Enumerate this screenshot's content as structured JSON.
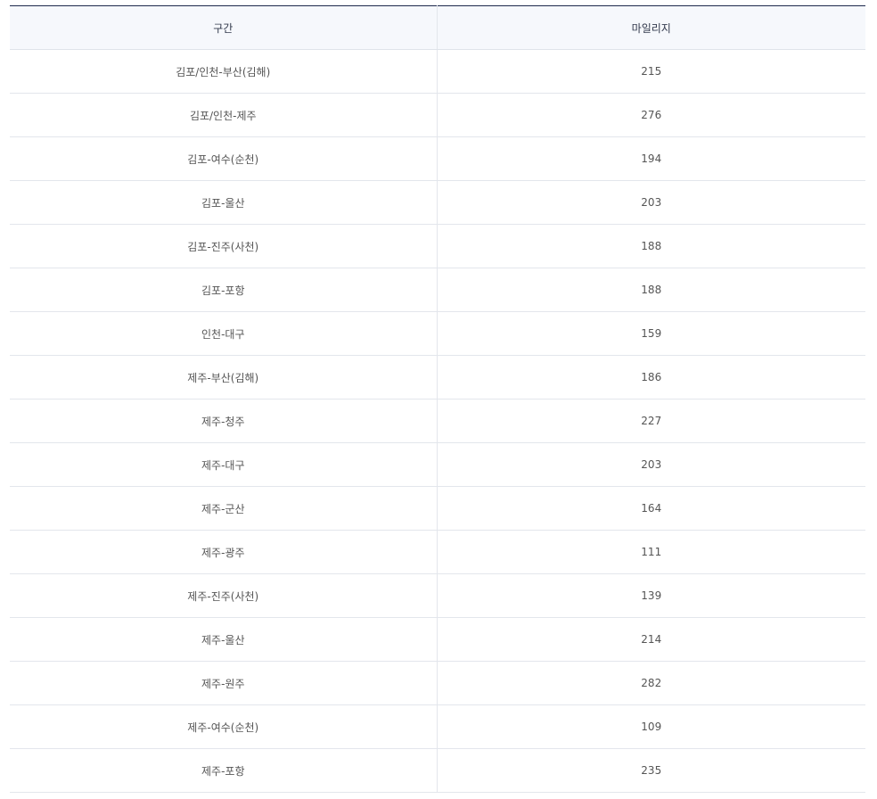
{
  "table": {
    "headers": [
      "구간",
      "마일리지"
    ],
    "rows": [
      [
        "김포/인천-부산(김해)",
        "215"
      ],
      [
        "김포/인천-제주",
        "276"
      ],
      [
        "김포-여수(순천)",
        "194"
      ],
      [
        "김포-울산",
        "203"
      ],
      [
        "김포-진주(사천)",
        "188"
      ],
      [
        "김포-포항",
        "188"
      ],
      [
        "인천-대구",
        "159"
      ],
      [
        "제주-부산(김해)",
        "186"
      ],
      [
        "제주-청주",
        "227"
      ],
      [
        "제주-대구",
        "203"
      ],
      [
        "제주-군산",
        "164"
      ],
      [
        "제주-광주",
        "111"
      ],
      [
        "제주-진주(사천)",
        "139"
      ],
      [
        "제주-울산",
        "214"
      ],
      [
        "제주-원주",
        "282"
      ],
      [
        "제주-여수(순천)",
        "109"
      ],
      [
        "제주-포항",
        "235"
      ]
    ]
  }
}
